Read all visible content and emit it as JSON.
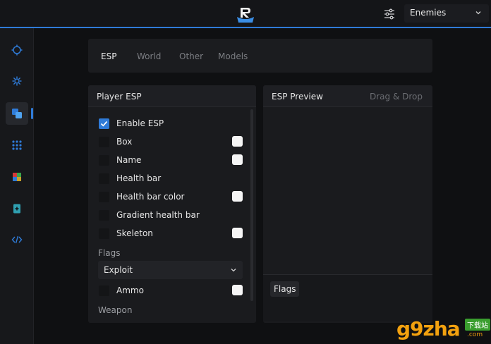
{
  "header": {
    "dropdown_value": "Enemies",
    "logo_icon": "app-logo-icon",
    "settings_icon": "sliders-icon",
    "accent": "#2f7bd8"
  },
  "sidebar": {
    "items": [
      {
        "icon": "crosshair-icon"
      },
      {
        "icon": "gear-icon"
      },
      {
        "icon": "layers-icon",
        "active": true
      },
      {
        "icon": "grid-icon"
      },
      {
        "icon": "palette-icon"
      },
      {
        "icon": "document-icon"
      },
      {
        "icon": "code-icon"
      }
    ]
  },
  "tabs": [
    "ESP",
    "World",
    "Other",
    "Models"
  ],
  "player_esp": {
    "title": "Player ESP",
    "options": [
      {
        "label": "Enable ESP",
        "checked": true,
        "color": false
      },
      {
        "label": "Box",
        "checked": false,
        "color": true
      },
      {
        "label": "Name",
        "checked": false,
        "color": true
      },
      {
        "label": "Health bar",
        "checked": false,
        "color": false
      },
      {
        "label": "Health bar color",
        "checked": false,
        "color": true
      },
      {
        "label": "Gradient health bar",
        "checked": false,
        "color": false
      },
      {
        "label": "Skeleton",
        "checked": false,
        "color": true
      }
    ],
    "flags_label": "Flags",
    "flags_select": "Exploit",
    "ammo_label": "Ammo",
    "weapon_label": "Weapon"
  },
  "preview": {
    "title": "ESP Preview",
    "hint": "Drag & Drop",
    "flags_chip": "Flags"
  },
  "watermark": {
    "brand": "g9zha",
    "chinese": "下载站",
    "domain": ".com"
  }
}
